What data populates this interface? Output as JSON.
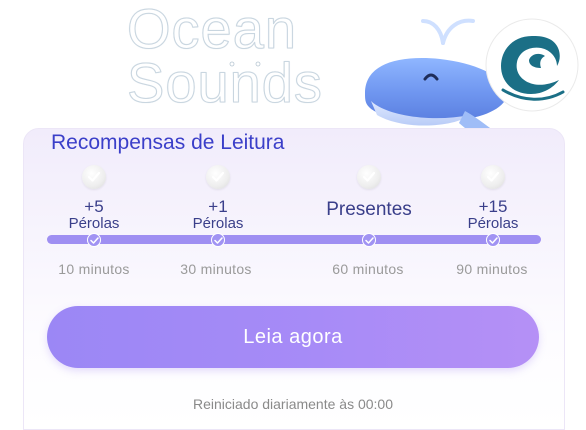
{
  "logo": {
    "line1": "Ocean",
    "line2": "Sounds"
  },
  "card": {
    "title": "Recompensas de Leitura",
    "milestones": [
      {
        "amount": "+5",
        "unit": "Pérolas",
        "time": "10 minutos",
        "completed": true
      },
      {
        "amount": "+1",
        "unit": "Pérolas",
        "time": "30 minutos",
        "completed": true
      },
      {
        "label": "Presentes",
        "time": "60 minutos",
        "completed": true
      },
      {
        "amount": "+15",
        "unit": "Pérolas",
        "time": "90 minutos",
        "completed": true
      }
    ],
    "button_label": "Leia agora",
    "footer": "Reiniciado diariamente às 00:00"
  },
  "icons": {
    "badge": "check-circle-icon",
    "node": "check-icon",
    "mascot": "whale-icon",
    "brand": "wave-logo-icon"
  },
  "colors": {
    "accent": "#9f8ff2",
    "title": "#3b3fc9",
    "button_start": "#9b87f5",
    "button_end": "#b590f6",
    "brand_teal": "#1b6f86"
  }
}
